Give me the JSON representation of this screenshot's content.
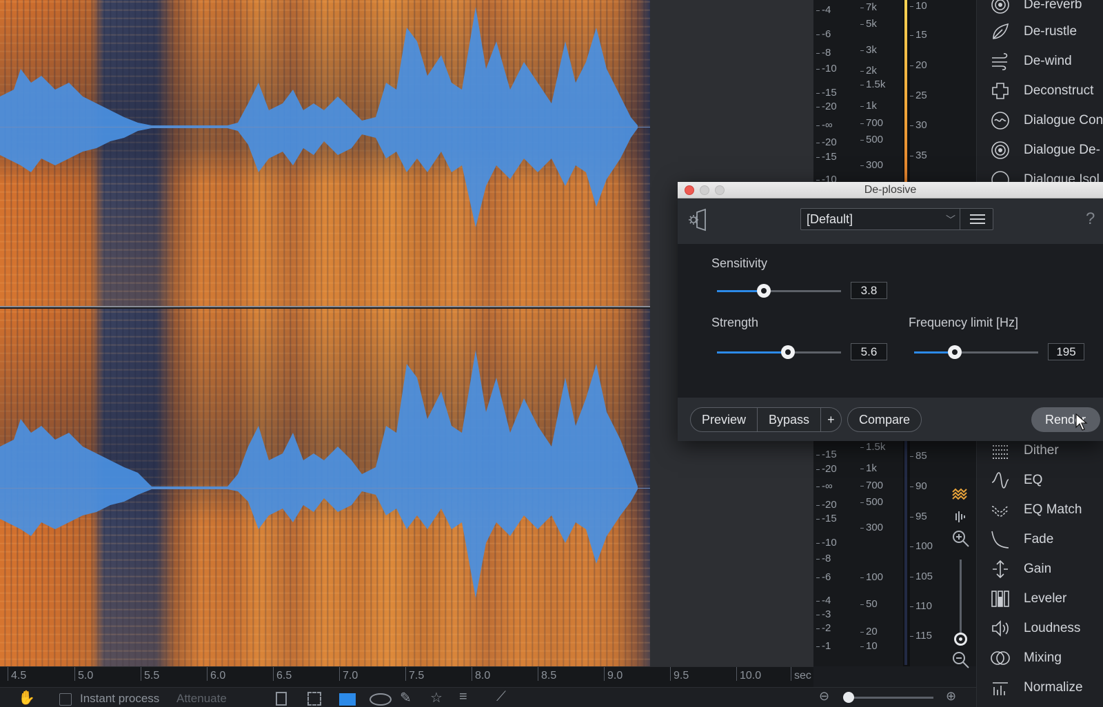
{
  "dialog": {
    "title": "De-plosive",
    "preset": "[Default]",
    "help": "?",
    "params": {
      "sensitivity": {
        "label": "Sensitivity",
        "value": "3.8",
        "fraction": 0.38
      },
      "strength": {
        "label": "Strength",
        "value": "5.6",
        "fraction": 0.57
      },
      "frequency": {
        "label": "Frequency limit [Hz]",
        "value": "195",
        "fraction": 0.33
      }
    },
    "footer": {
      "preview": "Preview",
      "bypass": "Bypass",
      "plus": "+",
      "compare": "Compare",
      "render": "Render"
    }
  },
  "modules": [
    {
      "label": "De-reverb",
      "icon": "de-reverb-icon"
    },
    {
      "label": "De-rustle",
      "icon": "de-rustle-icon"
    },
    {
      "label": "De-wind",
      "icon": "de-wind-icon"
    },
    {
      "label": "Deconstruct",
      "icon": "deconstruct-icon"
    },
    {
      "label": "Dialogue Con",
      "icon": "dialogue-contour-icon"
    },
    {
      "label": "Dialogue De-",
      "icon": "dialogue-de-reverb-icon"
    },
    {
      "label": "Dialogue Isol",
      "icon": "dialogue-isolate-icon"
    },
    {
      "label": "Dither",
      "icon": "dither-icon"
    },
    {
      "label": "EQ",
      "icon": "eq-icon"
    },
    {
      "label": "EQ Match",
      "icon": "eq-match-icon"
    },
    {
      "label": "Fade",
      "icon": "fade-icon"
    },
    {
      "label": "Gain",
      "icon": "gain-icon"
    },
    {
      "label": "Leveler",
      "icon": "leveler-icon"
    },
    {
      "label": "Loudness",
      "icon": "loudness-icon"
    },
    {
      "label": "Mixing",
      "icon": "mixing-icon"
    },
    {
      "label": "Normalize",
      "icon": "normalize-icon"
    }
  ],
  "db_ruler_top": [
    "-4",
    "-6",
    "-8",
    "-10",
    "-15",
    "-20",
    "-∞",
    "-20",
    "-15",
    "-10"
  ],
  "db_ruler_bottom": [
    "-15",
    "-20",
    "-∞",
    "-20",
    "-15",
    "-10",
    "-8",
    "-6",
    "-4",
    "-3",
    "-2",
    "-1"
  ],
  "hz_ruler_top": [
    "7k",
    "5k",
    "3k",
    "2k",
    "1.5k",
    "1k",
    "700",
    "500",
    "300"
  ],
  "hz_ruler_bottom": [
    "1.5k",
    "1k",
    "700",
    "500",
    "300",
    "100",
    "50",
    "20",
    "10"
  ],
  "level_ruler_top": [
    "10",
    "15",
    "20",
    "25",
    "30",
    "35"
  ],
  "level_ruler_bottom": [
    "85",
    "90",
    "95",
    "100",
    "105",
    "110",
    "115"
  ],
  "timeline": [
    "4.5",
    "5.0",
    "5.5",
    "6.0",
    "6.5",
    "7.0",
    "7.5",
    "8.0",
    "8.5",
    "9.0",
    "9.5",
    "10.0",
    "sec"
  ],
  "bottombar": {
    "instant_process": "Instant process",
    "mode": "Attenuate"
  },
  "colors": {
    "accent": "#2c8ae8",
    "waveform": "#4a90e2",
    "spectrogram": "#d4722e",
    "close": "#ee5a52"
  }
}
